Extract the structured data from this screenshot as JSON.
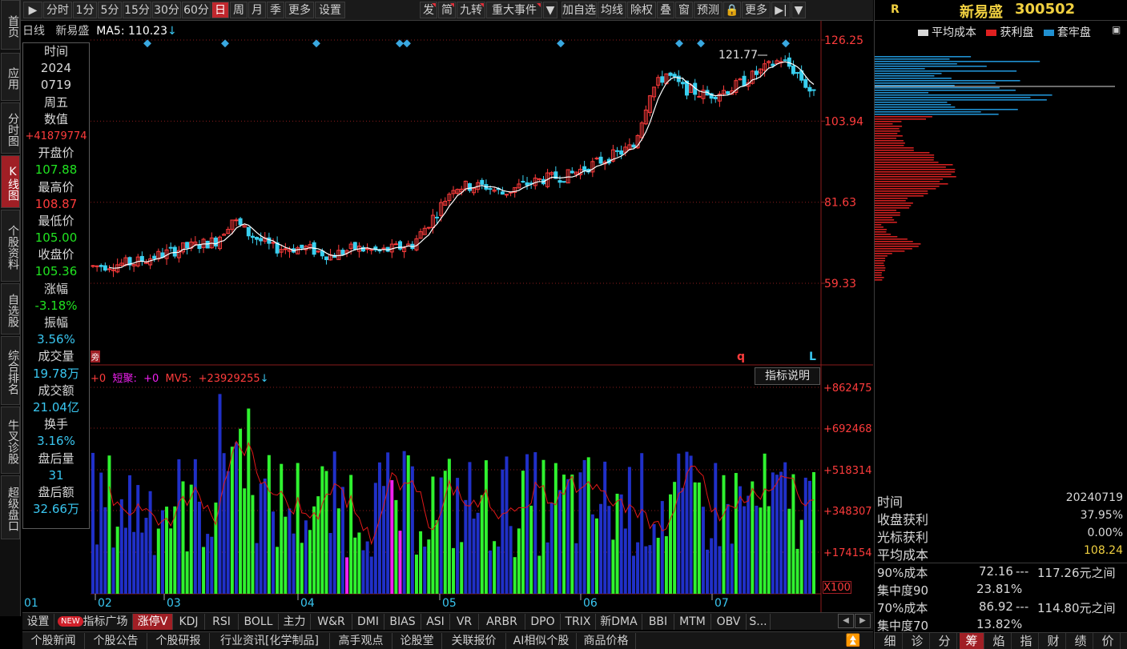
{
  "toolbar": {
    "items": [
      "▶",
      "分时",
      "1分",
      "5分",
      "15分",
      "30分",
      "60分",
      "日",
      "周",
      "月",
      "季",
      "更多",
      "设置",
      "发",
      "简",
      "九转",
      "重大事件",
      "▼",
      "加自选",
      "均线",
      "除权",
      "叠",
      "窗",
      "预测",
      "🔒",
      "更多",
      "▶|",
      "▼"
    ]
  },
  "left_nav": [
    "首页",
    "应用",
    "分时图",
    "K线图",
    "个股资料",
    "自选股",
    "综合排名",
    "牛叉诊股",
    "超级盘口"
  ],
  "chart_header": {
    "period": "日线",
    "stock_name": "新易盛",
    "ma_label": "MA5:",
    "ma_value": "110.23",
    "arrow": "↓"
  },
  "info_panel": {
    "time_label": "时间",
    "year": "2024",
    "date": "0719",
    "weekday": "周五",
    "value_label": "数值",
    "value": "+41879774",
    "open_label": "开盘价",
    "open": "107.88",
    "high_label": "最高价",
    "high": "108.87",
    "low_label": "最低价",
    "low": "105.00",
    "close_label": "收盘价",
    "close": "105.36",
    "change_label": "涨幅",
    "change": "-3.18%",
    "amplitude_label": "振幅",
    "amplitude": "3.56%",
    "volume_label": "成交量",
    "volume": "19.78万",
    "amount_label": "成交额",
    "amount": "21.04亿",
    "turnover_label": "换手",
    "turnover": "3.16%",
    "after_vol_label": "盘后量",
    "after_vol": "31",
    "after_amt_label": "盘后额",
    "after_amt": "32.66万"
  },
  "price_axis": [
    "126.25",
    "103.94",
    "81.63",
    "59.33"
  ],
  "peak_label": "121.77",
  "chart_markers": {
    "left": "旁",
    "q": "q",
    "L": "L"
  },
  "volume_header": {
    "a": "+0",
    "b": "短聚:",
    "c": "+0",
    "d": "MV5:",
    "e": "+23929255",
    "arrow": "↓"
  },
  "indicator_button": "指标说明",
  "volume_axis": [
    "+862475",
    "+692468",
    "+518314",
    "+348307",
    "+174154"
  ],
  "volume_unit": "X100",
  "months": [
    "01",
    "02",
    "03",
    "04",
    "05",
    "06",
    "07"
  ],
  "tabs_row1": [
    "设置",
    "NEW",
    "指标广场",
    "涨停V",
    "KDJ",
    "RSI",
    "BOLL",
    "主力",
    "W&R",
    "DMI",
    "BIAS",
    "ASI",
    "VR",
    "ARBR",
    "DPO",
    "TRIX",
    "新DMA",
    "BBI",
    "MTM",
    "OBV",
    "S..."
  ],
  "tabs_row2": [
    "个股新闻",
    "个股公告",
    "个股研报",
    "行业资讯[化学制品]",
    "高手观点",
    "论股堂",
    "关联报价",
    "AI相似个股",
    "商品价格"
  ],
  "right_panel": {
    "r_label": "R",
    "title": "新易盛",
    "code": "300502",
    "legend": [
      "平均成本",
      "获利盘",
      "套牢盘"
    ],
    "stats": [
      {
        "k": "时间",
        "v": "20240719"
      },
      {
        "k": "收盘获利",
        "v": "37.95%"
      },
      {
        "k": "光标获利",
        "v": "0.00%"
      },
      {
        "k": "平均成本",
        "v": "108.24"
      }
    ],
    "cost90": {
      "label": "90%成本",
      "low": "72.16",
      "sep": "---",
      "high": "117.26元之间"
    },
    "conc90": {
      "label": "集中度90",
      "value": "23.81%"
    },
    "cost70": {
      "label": "70%成本",
      "low": "86.92",
      "sep": "---",
      "high": "114.80元之间"
    },
    "conc70": {
      "label": "集中度70",
      "value": "13.82%"
    },
    "tabs": [
      "细",
      "诊",
      "分",
      "筹",
      "焰",
      "指",
      "财",
      "绩",
      "价"
    ]
  },
  "colors": {
    "up": "#ff3c3c",
    "down": "#39d0f0",
    "vol_up": "#2ff22f",
    "vol_down": "#2030c8",
    "limit": "#f020f0",
    "ma": "#ffffff",
    "grid": "#8a1d1d"
  }
}
